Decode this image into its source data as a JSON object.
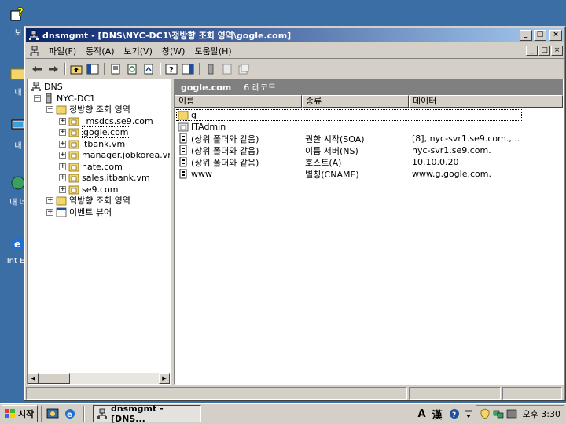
{
  "window": {
    "title": "dnsmgmt - [DNS\\NYC-DC1\\정방향 조회 영역\\gogle.com]",
    "controls": {
      "minimize": "_",
      "maximize": "□",
      "close": "×"
    }
  },
  "menubar": {
    "items": [
      "파일(F)",
      "동작(A)",
      "보기(V)",
      "창(W)",
      "도움말(H)"
    ]
  },
  "desktop": {
    "icons": [
      "보",
      "내",
      "내",
      "내 네",
      "Int Ex"
    ]
  },
  "tree": {
    "root": "DNS",
    "server": "NYC-DC1",
    "forward_zone": "정방향 조회 영역",
    "zones": [
      "_msdcs.se9.com",
      "gogle.com",
      "itbank.vm",
      "manager.jobkorea.vm",
      "nate.com",
      "sales.itbank.vm",
      "se9.com"
    ],
    "selected_zone": "gogle.com",
    "reverse_zone": "역방향 조회 영역",
    "event_viewer": "이벤트 뷰어"
  },
  "detail": {
    "header_title": "gogle.com",
    "header_count": "6 레코드",
    "columns": [
      "이름",
      "종류",
      "데이터"
    ],
    "records": [
      {
        "icon": "folder-icon",
        "name": "g",
        "type": "",
        "data": ""
      },
      {
        "icon": "folder-delegation-icon",
        "name": "ITAdmin",
        "type": "",
        "data": ""
      },
      {
        "icon": "record-icon",
        "name": "(상위 폴더와 같음)",
        "type": "권한 시작(SOA)",
        "data": "[8], nyc-svr1.se9.com.,..."
      },
      {
        "icon": "record-icon",
        "name": "(상위 폴더와 같음)",
        "type": "이름 서버(NS)",
        "data": "nyc-svr1.se9.com."
      },
      {
        "icon": "record-icon",
        "name": "(상위 폴더와 같음)",
        "type": "호스트(A)",
        "data": "10.10.0.20"
      },
      {
        "icon": "record-icon",
        "name": "www",
        "type": "별칭(CNAME)",
        "data": "www.g.gogle.com."
      }
    ]
  },
  "taskbar": {
    "start_label": "시작",
    "task_label": "dnsmgmt - [DNS...",
    "ime_a": "A",
    "ime_han": "漢",
    "clock": "오후 3:30"
  },
  "colors": {
    "desktop": "#3a6ea5",
    "title_gradient_start": "#0a246a",
    "title_gradient_end": "#a6caf0",
    "chrome": "#d4d0c8"
  }
}
